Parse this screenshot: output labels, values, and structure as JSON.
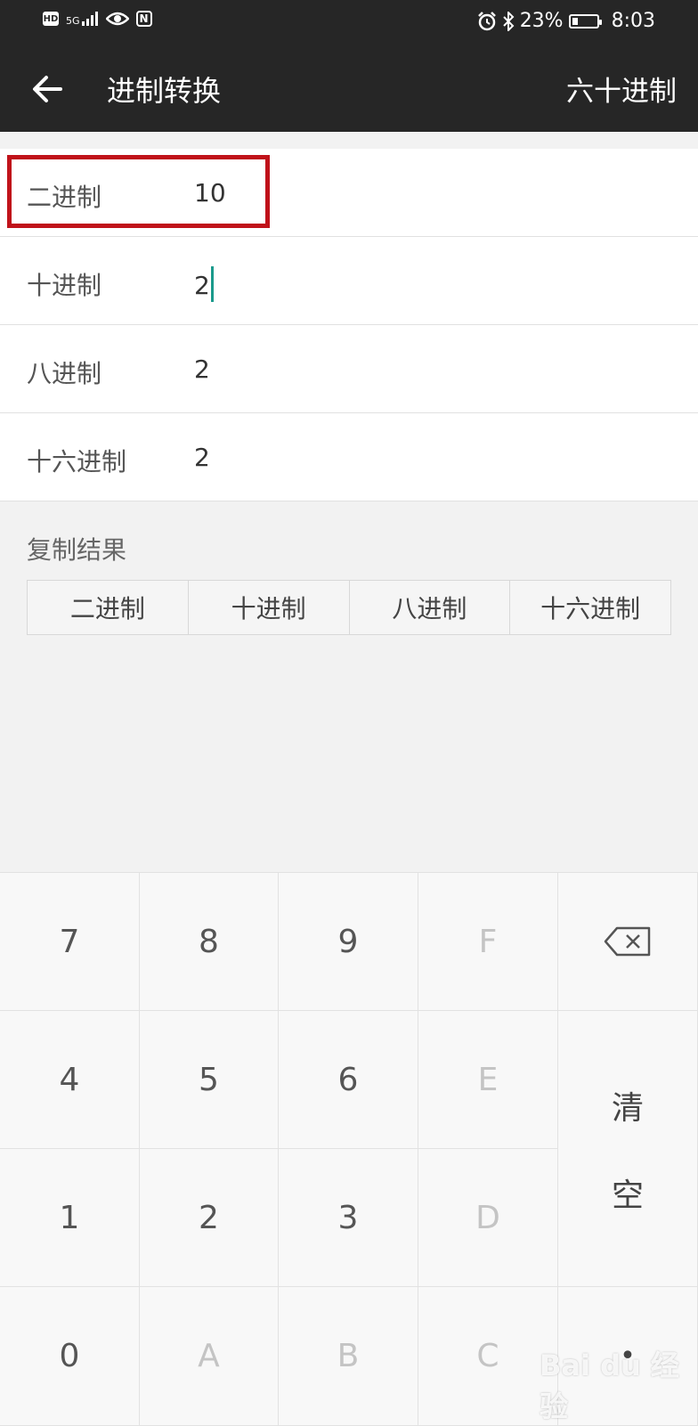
{
  "status_bar": {
    "left_icons": [
      "hd-icon",
      "5g-signal-icon",
      "eye-icon",
      "nfc-icon"
    ],
    "hd": "HD",
    "network": "5G",
    "nfc": "N",
    "battery_percent": "23%",
    "battery_level": 0.23,
    "time": "8:03"
  },
  "app_bar": {
    "title": "进制转换",
    "action": "六十进制"
  },
  "rows": [
    {
      "label": "二进制",
      "value": "10"
    },
    {
      "label": "十进制",
      "value": "2"
    },
    {
      "label": "八进制",
      "value": "2"
    },
    {
      "label": "十六进制",
      "value": "2"
    }
  ],
  "copy": {
    "title": "复制结果",
    "buttons": [
      "二进制",
      "十进制",
      "八进制",
      "十六进制"
    ]
  },
  "keypad": {
    "r1": [
      "7",
      "8",
      "9",
      "F"
    ],
    "r2": [
      "4",
      "5",
      "6",
      "E"
    ],
    "r3": [
      "1",
      "2",
      "3",
      "D"
    ],
    "r4": [
      "0",
      "A",
      "B",
      "C"
    ],
    "clear_1": "清",
    "clear_2": "空",
    "dot": "•"
  },
  "watermark": "Bai du 经验"
}
